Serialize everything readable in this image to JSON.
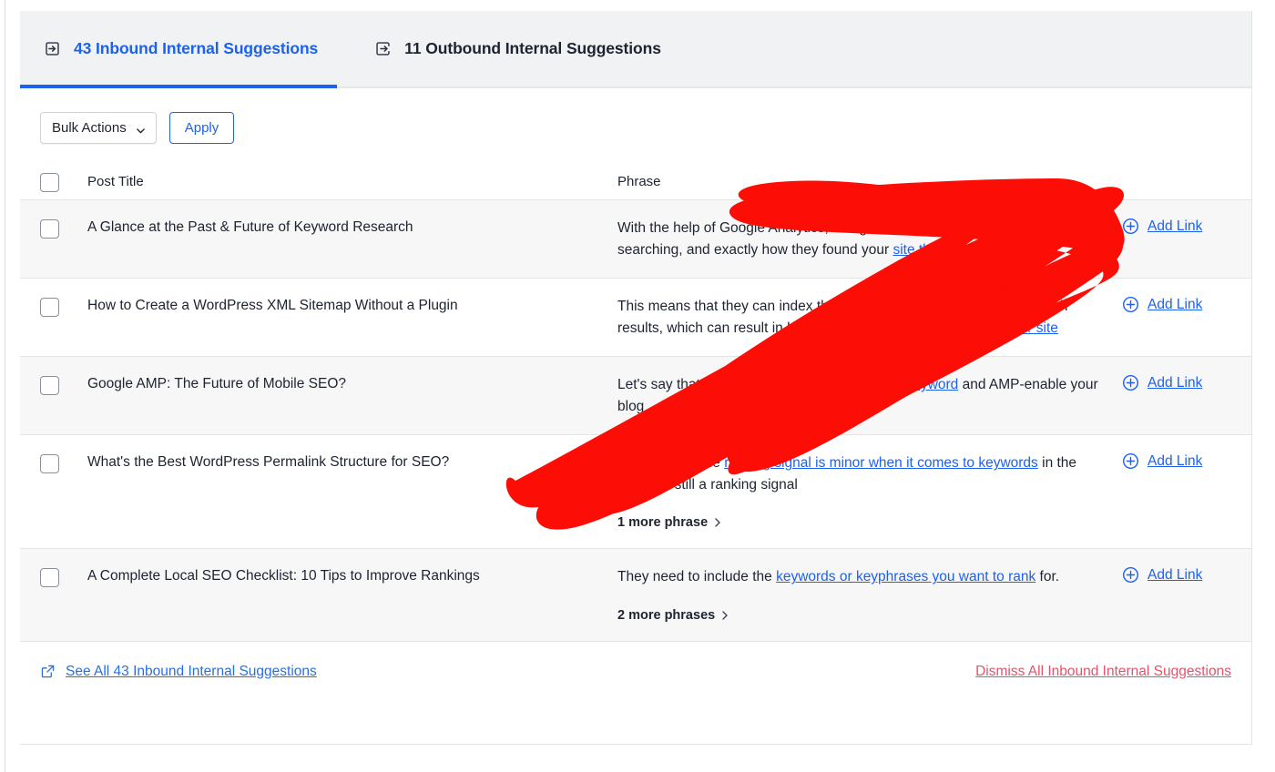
{
  "tabs": [
    {
      "label": "43 Inbound Internal Suggestions",
      "icon": "arrow-into-box-icon",
      "active": true,
      "count": 43,
      "color": "#1d61ef"
    },
    {
      "label": "11 Outbound Internal Suggestions",
      "icon": "arrow-out-of-box-icon",
      "active": false,
      "count": 11,
      "color": "#1e2330"
    }
  ],
  "toolbar": {
    "bulk_actions_label": "Bulk Actions",
    "bulk_actions_icon": "chevron-down-icon",
    "apply_label": "Apply"
  },
  "table": {
    "headers": {
      "select_all": "",
      "post_title": "Post Title",
      "phrase": "Phrase",
      "action": ""
    },
    "rows": [
      {
        "post_title": "A Glance at the Past & Future of Keyword Research",
        "phrase_parts": [
          {
            "text": "With the help of Google Analytics, Google told us ",
            "link": false
          },
          {
            "text": "how individuals were searching, and exactly how they found your ",
            "link": false
          },
          {
            "text": "site through keywords",
            "link": true
          }
        ],
        "more_label": "",
        "action_label": "Add Link",
        "action_icon": "plus-circle-icon",
        "stripe": true
      },
      {
        "post_title": "How to Create a WordPress XML Sitemap Without a Plugin",
        "phrase_parts": [
          {
            "text": "This means that they can index the content and start ranking it in search results, which can result in higher ",
            "link": false
          },
          {
            "text": "rankings and more traffic to your site",
            "link": true
          }
        ],
        "more_label": "",
        "action_label": "Add Link",
        "action_icon": "plus-circle-icon",
        "stripe": false
      },
      {
        "post_title": "Google AMP: The Future of Mobile SEO?",
        "phrase_parts": [
          {
            "text": "Let's say that you want to ",
            "link": false
          },
          {
            "text": "rank for a particular keyword",
            "link": true
          },
          {
            "text": " and AMP-enable your blog",
            "link": false
          }
        ],
        "more_label": "",
        "action_label": "Add Link",
        "action_icon": "plus-circle-icon",
        "stripe": true
      },
      {
        "post_title": "What's the Best WordPress Permalink Structure for SEO?",
        "phrase_parts": [
          {
            "text": "Even though the ",
            "link": false
          },
          {
            "text": "ranking signal is minor when it comes to keywords",
            "link": true
          },
          {
            "text": " in the URL, it’s still a ranking signal",
            "link": false
          }
        ],
        "more_label": "1 more phrase",
        "action_label": "Add Link",
        "action_icon": "plus-circle-icon",
        "stripe": false
      },
      {
        "post_title": "A Complete Local SEO Checklist: 10 Tips to Improve Rankings",
        "phrase_parts": [
          {
            "text": "They need to include the ",
            "link": false
          },
          {
            "text": "keywords or keyphrases you want to rank",
            "link": true
          },
          {
            "text": " for.",
            "link": false
          }
        ],
        "more_label": "2 more phrases",
        "action_label": "Add Link",
        "action_icon": "plus-circle-icon",
        "stripe": true
      }
    ]
  },
  "footer": {
    "see_all_label": "See All 43 Inbound Internal Suggestions",
    "see_all_icon": "external-link-icon",
    "dismiss_label": "Dismiss All Inbound Internal Suggestions",
    "dismiss_color": "#e4536b"
  },
  "annotation": {
    "type": "hand-drawn-arrow",
    "color": "#fc0d06",
    "direction": "up-right",
    "points_to": "Add Link"
  }
}
